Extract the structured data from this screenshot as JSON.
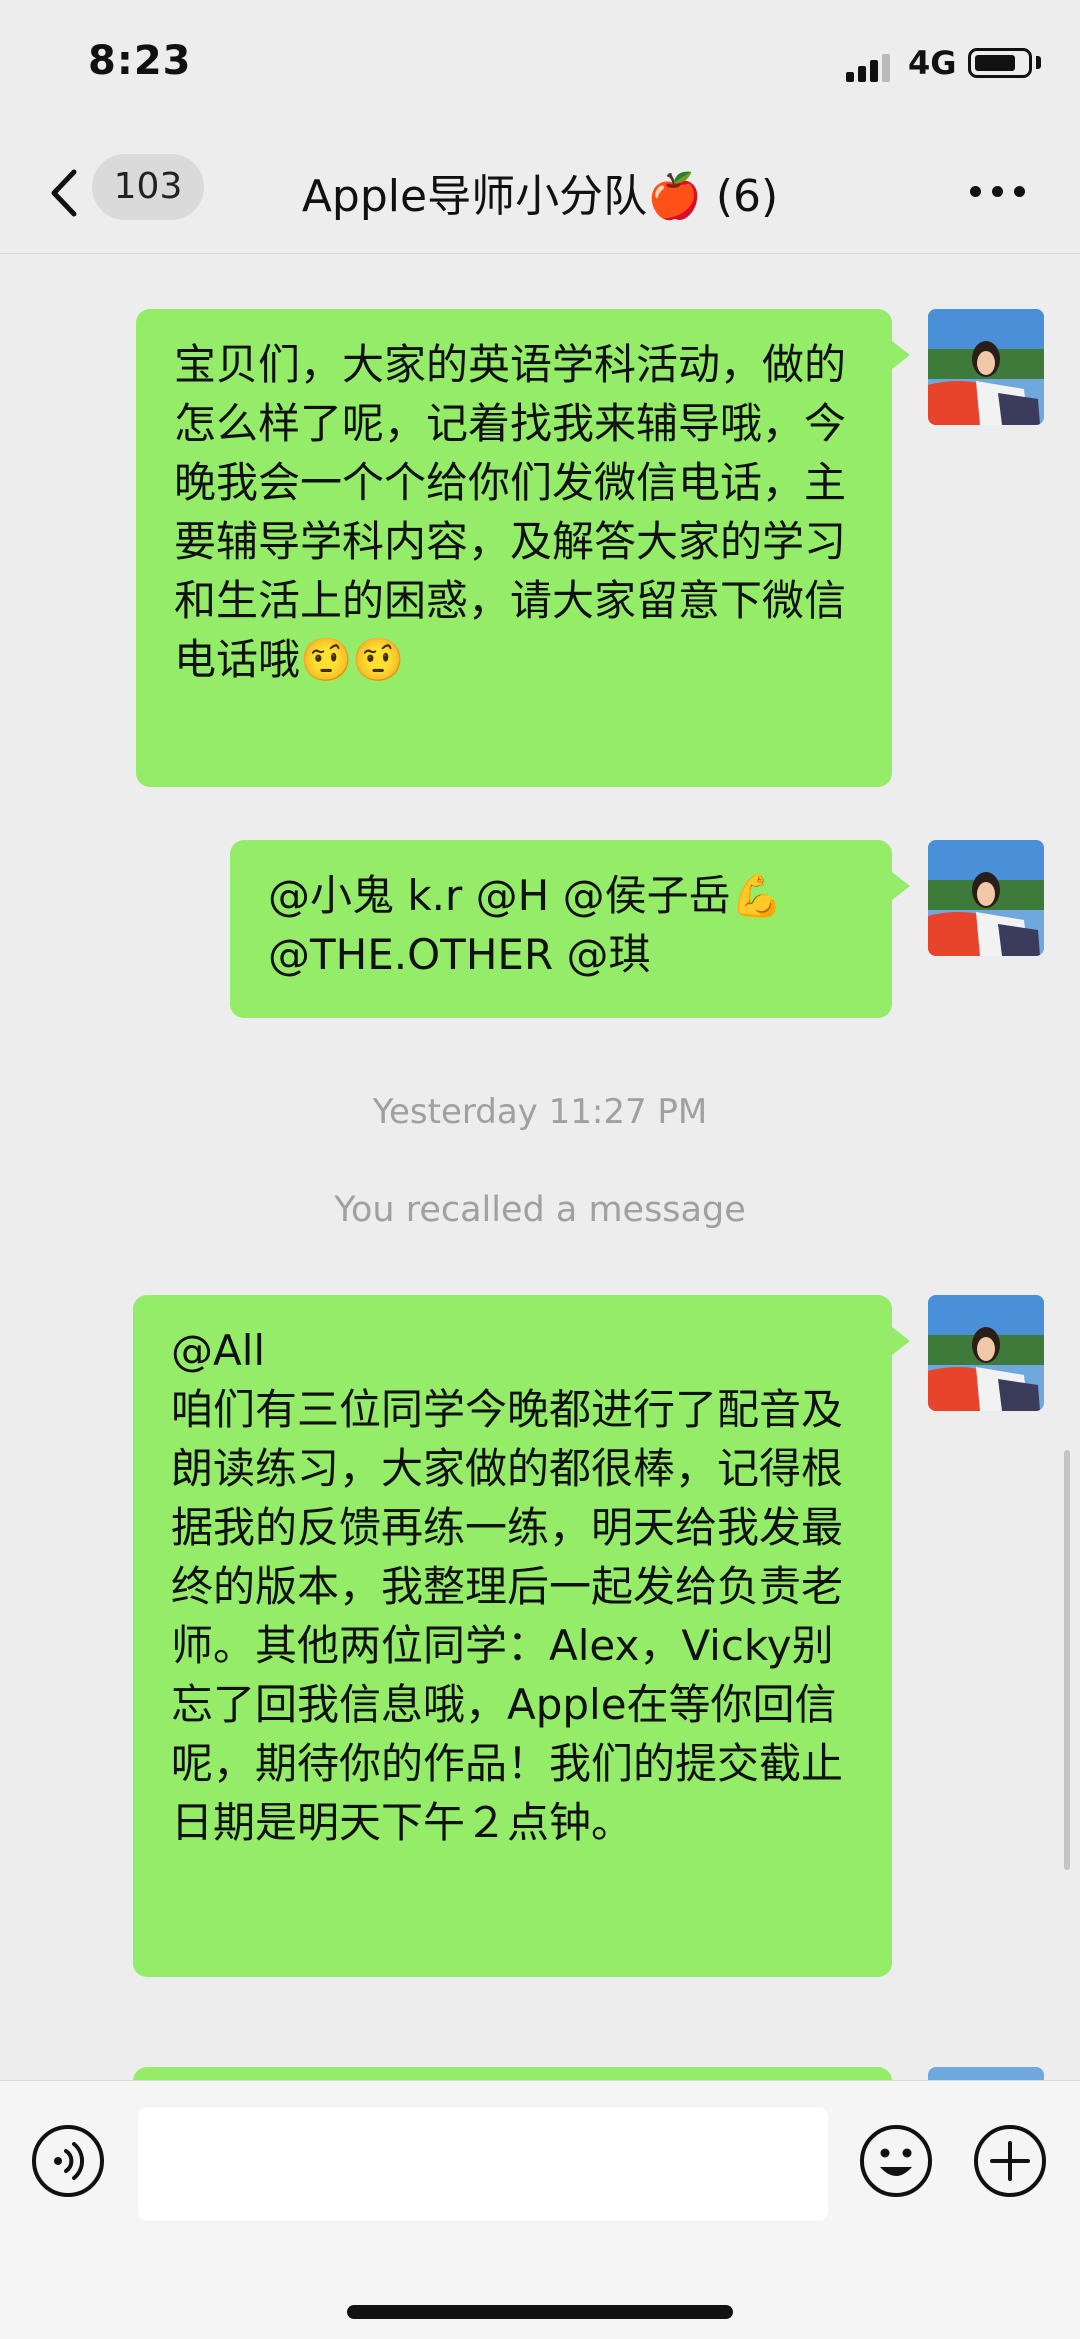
{
  "status_bar": {
    "time": "8:23",
    "network": "4G"
  },
  "header": {
    "back_count": "103",
    "title": "Apple导师小分队🍎 (6)"
  },
  "messages": [
    {
      "type": "text",
      "text": "宝贝们，大家的英语学科活动，做的怎么样了呢，记着找我来辅导哦，今晚我会一个个给你们发微信电话，主要辅导学科内容，及解答大家的学习和生活上的困惑，请大家留意下微信电话哦🤨🤨"
    },
    {
      "type": "text",
      "text": "@小鬼 k.r @H @侯子岳💪\n@THE.OTHER @琪"
    },
    {
      "type": "time",
      "text": "Yesterday 11:27 PM"
    },
    {
      "type": "system",
      "text": "You recalled a message"
    },
    {
      "type": "text",
      "text": "@All\n咱们有三位同学今晚都进行了配音及朗读练习，大家做的都很棒，记得根据我的反馈再练一练，明天给我发最终的版本，我整理后一起发给负责老师。其他两位同学：Alex，Vicky别忘了回我信息哦，Apple在等你回信呢，期待你的作品！我们的提交截止日期是明天下午２点钟。"
    }
  ],
  "input_bar": {
    "placeholder": ""
  },
  "colors": {
    "bubble": "#95ec69",
    "background": "#ededed"
  }
}
